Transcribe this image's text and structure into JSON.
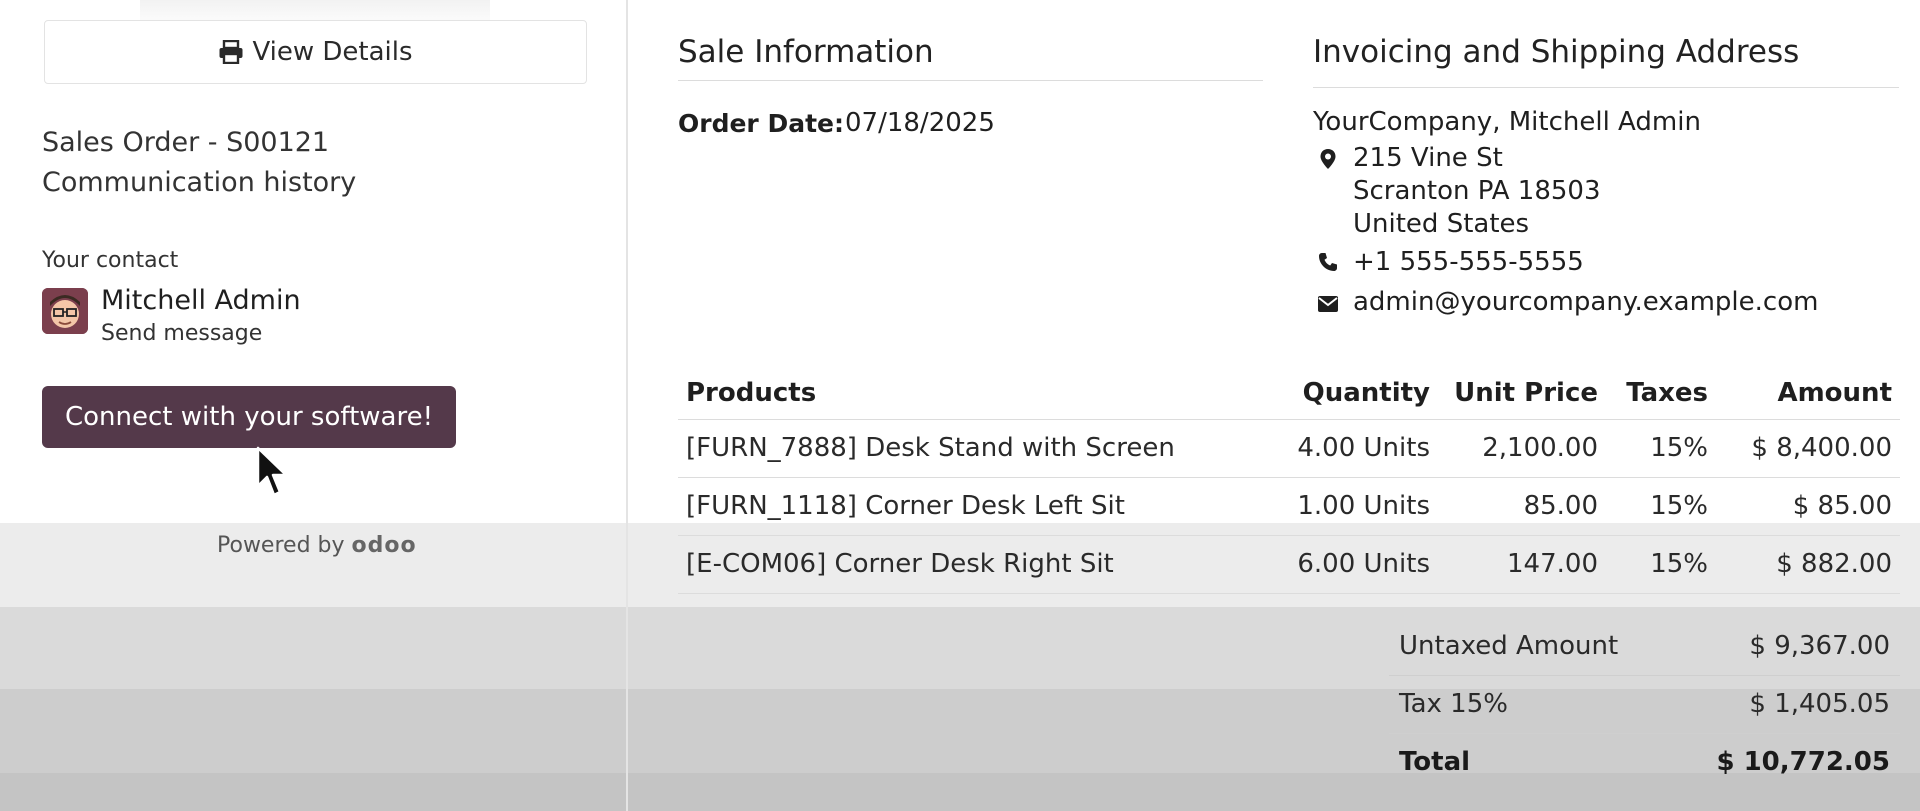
{
  "sidebar": {
    "view_details_label": "View Details",
    "order_title": "Sales Order - S00121",
    "history_label": "Communication history",
    "contact_label": "Your contact",
    "contact_name": "Mitchell Admin",
    "send_message_label": "Send message",
    "connect_button_label": "Connect with your software!",
    "powered_by_label": "Powered by",
    "powered_by_brand": "odoo"
  },
  "sale_info": {
    "title": "Sale Information",
    "order_date_label": "Order Date:",
    "order_date_value": "07/18/2025"
  },
  "address": {
    "title": "Invoicing and Shipping Address",
    "company": "YourCompany, Mitchell Admin",
    "street": "215 Vine St",
    "city_line": "Scranton PA 18503",
    "country": "United States",
    "phone": "+1 555-555-5555",
    "email": "admin@yourcompany.example.com"
  },
  "products": {
    "headers": {
      "product": "Products",
      "quantity": "Quantity",
      "unit_price": "Unit Price",
      "taxes": "Taxes",
      "amount": "Amount"
    },
    "rows": [
      {
        "product": "[FURN_7888] Desk Stand with Screen",
        "quantity": "4.00 Units",
        "unit_price": "2,100.00",
        "taxes": "15%",
        "amount": "$ 8,400.00"
      },
      {
        "product": "[FURN_1118] Corner Desk Left Sit",
        "quantity": "1.00 Units",
        "unit_price": "85.00",
        "taxes": "15%",
        "amount": "$ 85.00"
      },
      {
        "product": "[E-COM06] Corner Desk Right Sit",
        "quantity": "6.00 Units",
        "unit_price": "147.00",
        "taxes": "15%",
        "amount": "$ 882.00"
      }
    ]
  },
  "totals": {
    "untaxed_label": "Untaxed Amount",
    "untaxed_value": "$ 9,367.00",
    "tax_label": "Tax 15%",
    "tax_value": "$ 1,405.05",
    "total_label": "Total",
    "total_value": "$ 10,772.05"
  },
  "colors": {
    "brand_button": "#54394a",
    "text": "#1f1f1f",
    "rule": "#dcdcdc"
  }
}
